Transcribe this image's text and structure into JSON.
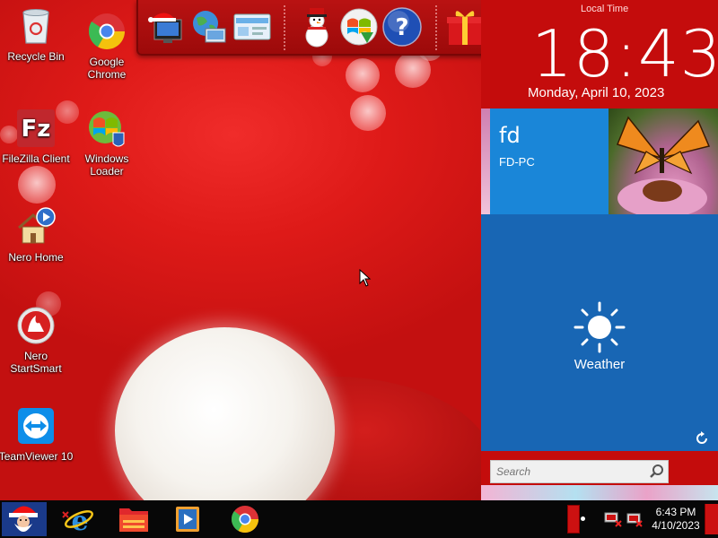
{
  "desktop": {
    "icons": [
      {
        "label": "Recycle Bin",
        "icon": "recycle-bin-icon"
      },
      {
        "label": "Google Chrome",
        "icon": "chrome-icon"
      },
      {
        "label": "FileZilla Client",
        "icon": "filezilla-icon"
      },
      {
        "label": "Windows Loader",
        "icon": "windows-loader-icon"
      },
      {
        "label": "Nero Home",
        "icon": "nero-home-icon"
      },
      {
        "label": "Nero StartSmart",
        "icon": "nero-startsmart-icon"
      },
      {
        "label": "TeamViewer 10",
        "icon": "teamviewer-icon"
      }
    ]
  },
  "dock": {
    "items": [
      "santa-computer-icon",
      "network-globe-icon",
      "control-panel-icon",
      "snowman-icon",
      "windows-logo-icon",
      "help-icon",
      "gift-box-icon",
      "folder-icon",
      "trash-icon"
    ]
  },
  "side_panel": {
    "clock_title": "Local Time",
    "clock_time": "18:43",
    "clock_date": "Monday, April 10, 2023",
    "user_tile": {
      "name": "fd",
      "host": "FD-PC"
    },
    "weather_tile": {
      "label": "Weather"
    },
    "search": {
      "placeholder": "Search"
    }
  },
  "taskbar": {
    "apps": [
      "internet-explorer-icon",
      "file-explorer-icon",
      "media-player-icon",
      "chrome-icon"
    ],
    "tray_time": "6:43 PM",
    "tray_date": "4/10/2023"
  },
  "colors": {
    "wallpaper_red": "#d41414",
    "tile_blue": "#1a86d8",
    "weather_blue": "#1866b4",
    "taskbar": "#070707"
  }
}
